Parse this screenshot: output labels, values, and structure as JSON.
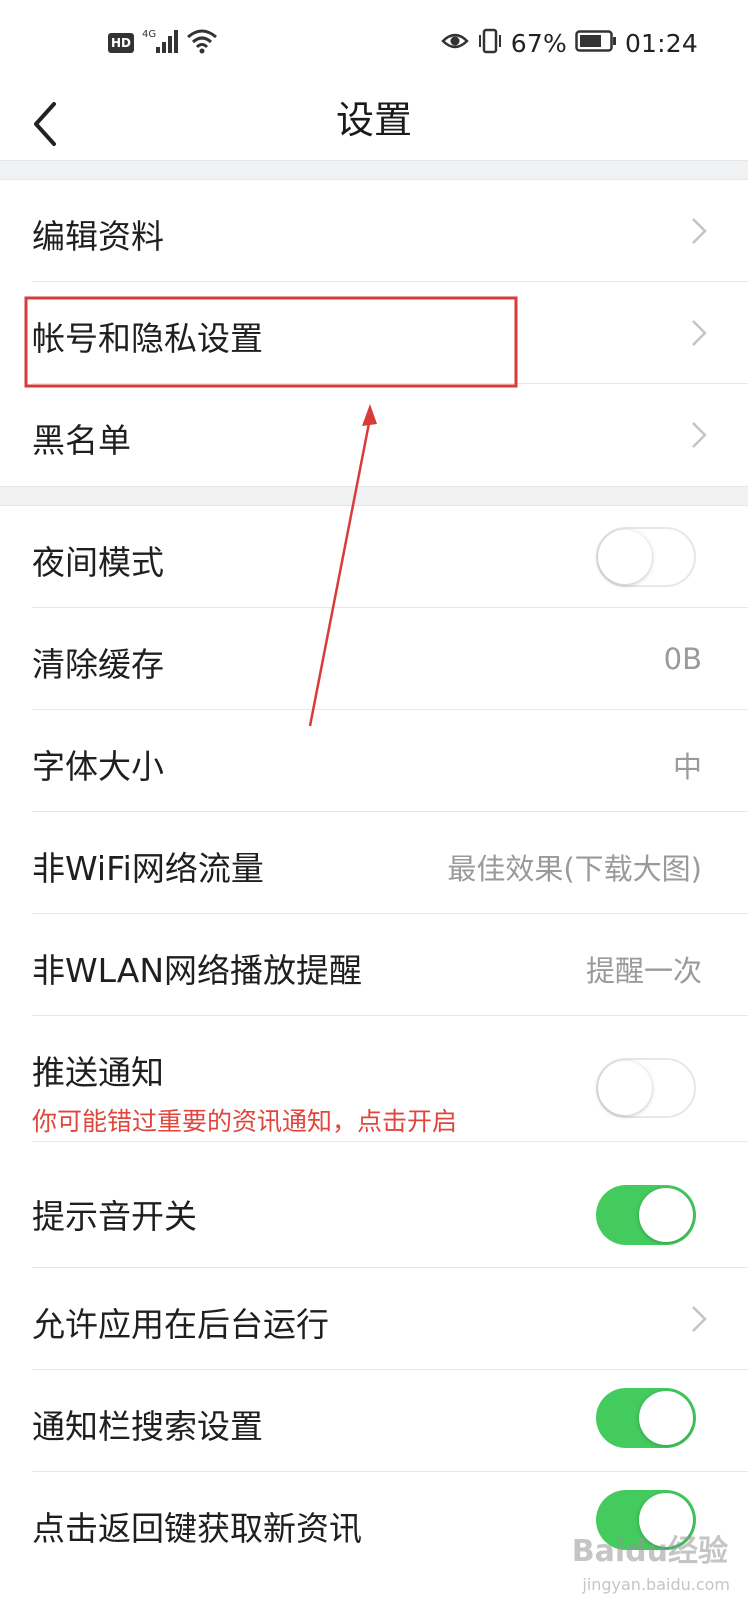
{
  "status_bar": {
    "hd_badge": "HD",
    "network": "4G",
    "battery_percent": "67%",
    "time": "01:24"
  },
  "header": {
    "title": "设置"
  },
  "rows": {
    "edit_profile": "编辑资料",
    "account_privacy": "帐号和隐私设置",
    "blacklist": "黑名单",
    "night_mode": "夜间模式",
    "clear_cache": "清除缓存",
    "clear_cache_value": "0B",
    "font_size": "字体大小",
    "font_size_value": "中",
    "non_wifi_traffic": "非WiFi网络流量",
    "non_wifi_traffic_value": "最佳效果(下载大图)",
    "non_wlan_play": "非WLAN网络播放提醒",
    "non_wlan_play_value": "提醒一次",
    "push_notify": "推送通知",
    "push_notify_hint": "你可能错过重要的资讯通知，点击开启",
    "sound_switch": "提示音开关",
    "background_run": "允许应用在后台运行",
    "notify_search": "通知栏搜索设置",
    "back_key_refresh": "点击返回键获取新资讯"
  },
  "toggles": {
    "night_mode": false,
    "push_notify": false,
    "sound_switch": true,
    "notify_search": true,
    "back_key_refresh": true
  },
  "watermark": {
    "main": "Baidu经验",
    "sub": "jingyan.baidu.com"
  },
  "colors": {
    "toggle_on": "#43cb5e",
    "hint_red": "#e0463c",
    "annotation_red": "#d93a3a"
  }
}
